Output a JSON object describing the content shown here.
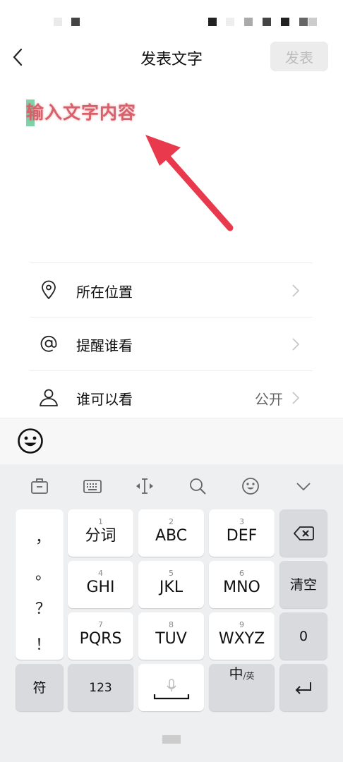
{
  "header": {
    "title": "发表文字",
    "publish_label": "发表"
  },
  "editor": {
    "placeholder": "输入文字内容"
  },
  "options": [
    {
      "label": "所在位置",
      "icon": "location-pin-icon",
      "value": ""
    },
    {
      "label": "提醒谁看",
      "icon": "at-sign-icon",
      "value": ""
    },
    {
      "label": "谁可以看",
      "icon": "person-icon",
      "value": "公开"
    }
  ],
  "emoji_bar": {
    "icon": "emoji-smiley-icon"
  },
  "keyboard": {
    "toolbar": [
      "toolbox-icon",
      "keyboard-icon",
      "cursor-move-icon",
      "search-icon",
      "emoji-icon",
      "collapse-keyboard-icon"
    ],
    "punctuation": [
      "，",
      "。",
      "？",
      "！"
    ],
    "keys": [
      {
        "num": "1",
        "label": "分词"
      },
      {
        "num": "2",
        "label": "ABC"
      },
      {
        "num": "3",
        "label": "DEF"
      },
      {
        "num": "4",
        "label": "GHI"
      },
      {
        "num": "5",
        "label": "JKL"
      },
      {
        "num": "6",
        "label": "MNO"
      },
      {
        "num": "7",
        "label": "PQRS"
      },
      {
        "num": "8",
        "label": "TUV"
      },
      {
        "num": "9",
        "label": "WXYZ"
      }
    ],
    "clear_label": "清空",
    "zero_label": "0",
    "symbol_label": "符",
    "num_label": "123",
    "lang_main": "中",
    "lang_sub": "/英"
  },
  "colors": {
    "placeholder_red": "#d7606a",
    "arrow_red": "#e8394d",
    "cursor_green": "#7ed3a8",
    "keyboard_bg": "#eeeff1",
    "func_key_gray": "#d9dade"
  }
}
